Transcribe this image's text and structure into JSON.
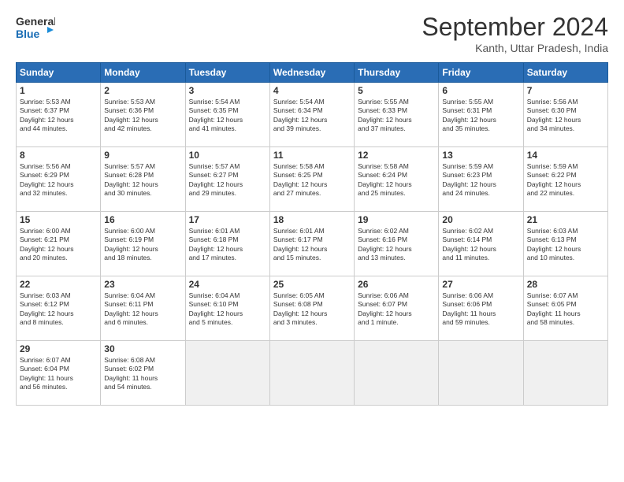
{
  "header": {
    "logo_line1": "General",
    "logo_line2": "Blue",
    "month": "September 2024",
    "location": "Kanth, Uttar Pradesh, India"
  },
  "weekdays": [
    "Sunday",
    "Monday",
    "Tuesday",
    "Wednesday",
    "Thursday",
    "Friday",
    "Saturday"
  ],
  "days": [
    {
      "num": "",
      "info": ""
    },
    {
      "num": "",
      "info": ""
    },
    {
      "num": "",
      "info": ""
    },
    {
      "num": "",
      "info": ""
    },
    {
      "num": "",
      "info": ""
    },
    {
      "num": "",
      "info": ""
    },
    {
      "num": "",
      "info": ""
    },
    {
      "num": "1",
      "info": "Sunrise: 5:53 AM\nSunset: 6:37 PM\nDaylight: 12 hours\nand 44 minutes."
    },
    {
      "num": "2",
      "info": "Sunrise: 5:53 AM\nSunset: 6:36 PM\nDaylight: 12 hours\nand 42 minutes."
    },
    {
      "num": "3",
      "info": "Sunrise: 5:54 AM\nSunset: 6:35 PM\nDaylight: 12 hours\nand 41 minutes."
    },
    {
      "num": "4",
      "info": "Sunrise: 5:54 AM\nSunset: 6:34 PM\nDaylight: 12 hours\nand 39 minutes."
    },
    {
      "num": "5",
      "info": "Sunrise: 5:55 AM\nSunset: 6:33 PM\nDaylight: 12 hours\nand 37 minutes."
    },
    {
      "num": "6",
      "info": "Sunrise: 5:55 AM\nSunset: 6:31 PM\nDaylight: 12 hours\nand 35 minutes."
    },
    {
      "num": "7",
      "info": "Sunrise: 5:56 AM\nSunset: 6:30 PM\nDaylight: 12 hours\nand 34 minutes."
    },
    {
      "num": "8",
      "info": "Sunrise: 5:56 AM\nSunset: 6:29 PM\nDaylight: 12 hours\nand 32 minutes."
    },
    {
      "num": "9",
      "info": "Sunrise: 5:57 AM\nSunset: 6:28 PM\nDaylight: 12 hours\nand 30 minutes."
    },
    {
      "num": "10",
      "info": "Sunrise: 5:57 AM\nSunset: 6:27 PM\nDaylight: 12 hours\nand 29 minutes."
    },
    {
      "num": "11",
      "info": "Sunrise: 5:58 AM\nSunset: 6:25 PM\nDaylight: 12 hours\nand 27 minutes."
    },
    {
      "num": "12",
      "info": "Sunrise: 5:58 AM\nSunset: 6:24 PM\nDaylight: 12 hours\nand 25 minutes."
    },
    {
      "num": "13",
      "info": "Sunrise: 5:59 AM\nSunset: 6:23 PM\nDaylight: 12 hours\nand 24 minutes."
    },
    {
      "num": "14",
      "info": "Sunrise: 5:59 AM\nSunset: 6:22 PM\nDaylight: 12 hours\nand 22 minutes."
    },
    {
      "num": "15",
      "info": "Sunrise: 6:00 AM\nSunset: 6:21 PM\nDaylight: 12 hours\nand 20 minutes."
    },
    {
      "num": "16",
      "info": "Sunrise: 6:00 AM\nSunset: 6:19 PM\nDaylight: 12 hours\nand 18 minutes."
    },
    {
      "num": "17",
      "info": "Sunrise: 6:01 AM\nSunset: 6:18 PM\nDaylight: 12 hours\nand 17 minutes."
    },
    {
      "num": "18",
      "info": "Sunrise: 6:01 AM\nSunset: 6:17 PM\nDaylight: 12 hours\nand 15 minutes."
    },
    {
      "num": "19",
      "info": "Sunrise: 6:02 AM\nSunset: 6:16 PM\nDaylight: 12 hours\nand 13 minutes."
    },
    {
      "num": "20",
      "info": "Sunrise: 6:02 AM\nSunset: 6:14 PM\nDaylight: 12 hours\nand 11 minutes."
    },
    {
      "num": "21",
      "info": "Sunrise: 6:03 AM\nSunset: 6:13 PM\nDaylight: 12 hours\nand 10 minutes."
    },
    {
      "num": "22",
      "info": "Sunrise: 6:03 AM\nSunset: 6:12 PM\nDaylight: 12 hours\nand 8 minutes."
    },
    {
      "num": "23",
      "info": "Sunrise: 6:04 AM\nSunset: 6:11 PM\nDaylight: 12 hours\nand 6 minutes."
    },
    {
      "num": "24",
      "info": "Sunrise: 6:04 AM\nSunset: 6:10 PM\nDaylight: 12 hours\nand 5 minutes."
    },
    {
      "num": "25",
      "info": "Sunrise: 6:05 AM\nSunset: 6:08 PM\nDaylight: 12 hours\nand 3 minutes."
    },
    {
      "num": "26",
      "info": "Sunrise: 6:06 AM\nSunset: 6:07 PM\nDaylight: 12 hours\nand 1 minute."
    },
    {
      "num": "27",
      "info": "Sunrise: 6:06 AM\nSunset: 6:06 PM\nDaylight: 11 hours\nand 59 minutes."
    },
    {
      "num": "28",
      "info": "Sunrise: 6:07 AM\nSunset: 6:05 PM\nDaylight: 11 hours\nand 58 minutes."
    },
    {
      "num": "29",
      "info": "Sunrise: 6:07 AM\nSunset: 6:04 PM\nDaylight: 11 hours\nand 56 minutes."
    },
    {
      "num": "30",
      "info": "Sunrise: 6:08 AM\nSunset: 6:02 PM\nDaylight: 11 hours\nand 54 minutes."
    },
    {
      "num": "",
      "info": ""
    },
    {
      "num": "",
      "info": ""
    },
    {
      "num": "",
      "info": ""
    },
    {
      "num": "",
      "info": ""
    },
    {
      "num": "",
      "info": ""
    }
  ]
}
